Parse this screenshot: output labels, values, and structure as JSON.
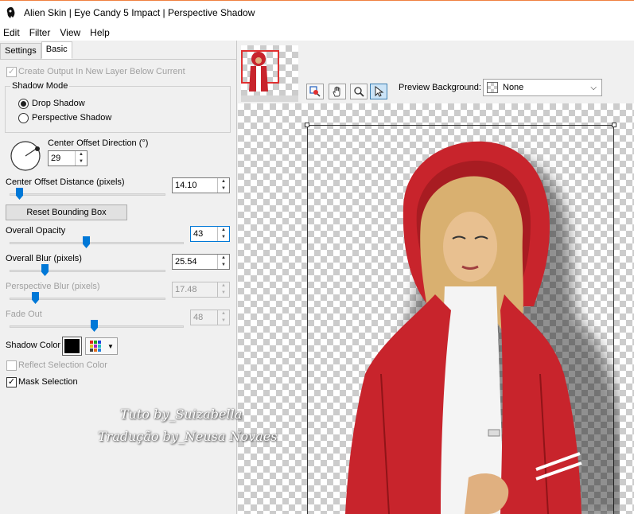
{
  "window": {
    "title": "Alien Skin | Eye Candy 5 Impact | Perspective Shadow"
  },
  "menu": [
    "Edit",
    "Filter",
    "View",
    "Help"
  ],
  "tabs": [
    {
      "label": "Settings",
      "active": false
    },
    {
      "label": "Basic",
      "active": true
    }
  ],
  "basic": {
    "create_output_label": "Create Output In New Layer Below Current",
    "create_output_checked": true,
    "shadow_mode": {
      "legend": "Shadow Mode",
      "options": [
        {
          "label": "Drop Shadow",
          "selected": true
        },
        {
          "label": "Perspective Shadow",
          "selected": false
        }
      ]
    },
    "center_offset_direction": {
      "label": "Center Offset Direction (°)",
      "value": "29"
    },
    "center_offset_distance": {
      "label": "Center Offset Distance (pixels)",
      "value": "14.10",
      "fraction": 0.08
    },
    "reset_bounding_box_label": "Reset Bounding Box",
    "overall_opacity": {
      "label": "Overall Opacity",
      "value": "43",
      "fraction": 0.43
    },
    "overall_blur": {
      "label": "Overall Blur (pixels)",
      "value": "25.54",
      "fraction": 0.24
    },
    "perspective_blur": {
      "label": "Perspective Blur (pixels)",
      "value": "17.48",
      "fraction": 0.17,
      "disabled": true
    },
    "fade_out": {
      "label": "Fade Out",
      "value": "48",
      "fraction": 0.48,
      "disabled": true
    },
    "shadow_color": {
      "label": "Shadow Color",
      "color": "#000000"
    },
    "reflect_selection_color": {
      "label": "Reflect Selection Color",
      "checked": false,
      "disabled": true
    },
    "mask_selection": {
      "label": "Mask Selection",
      "checked": true
    }
  },
  "preview": {
    "background_label": "Preview Background:",
    "background_value": "None",
    "tools": [
      "magnify-preview-icon",
      "hand-pan-icon",
      "zoom-icon",
      "pointer-icon"
    ]
  },
  "watermark": {
    "line1": "Tuto by_Suizabella",
    "line2": "Tradução by_Neusa Novaes"
  },
  "colors": {
    "accent": "#0078d7",
    "title_bar_accent": "#f08040",
    "coat_red": "#c8242c"
  }
}
